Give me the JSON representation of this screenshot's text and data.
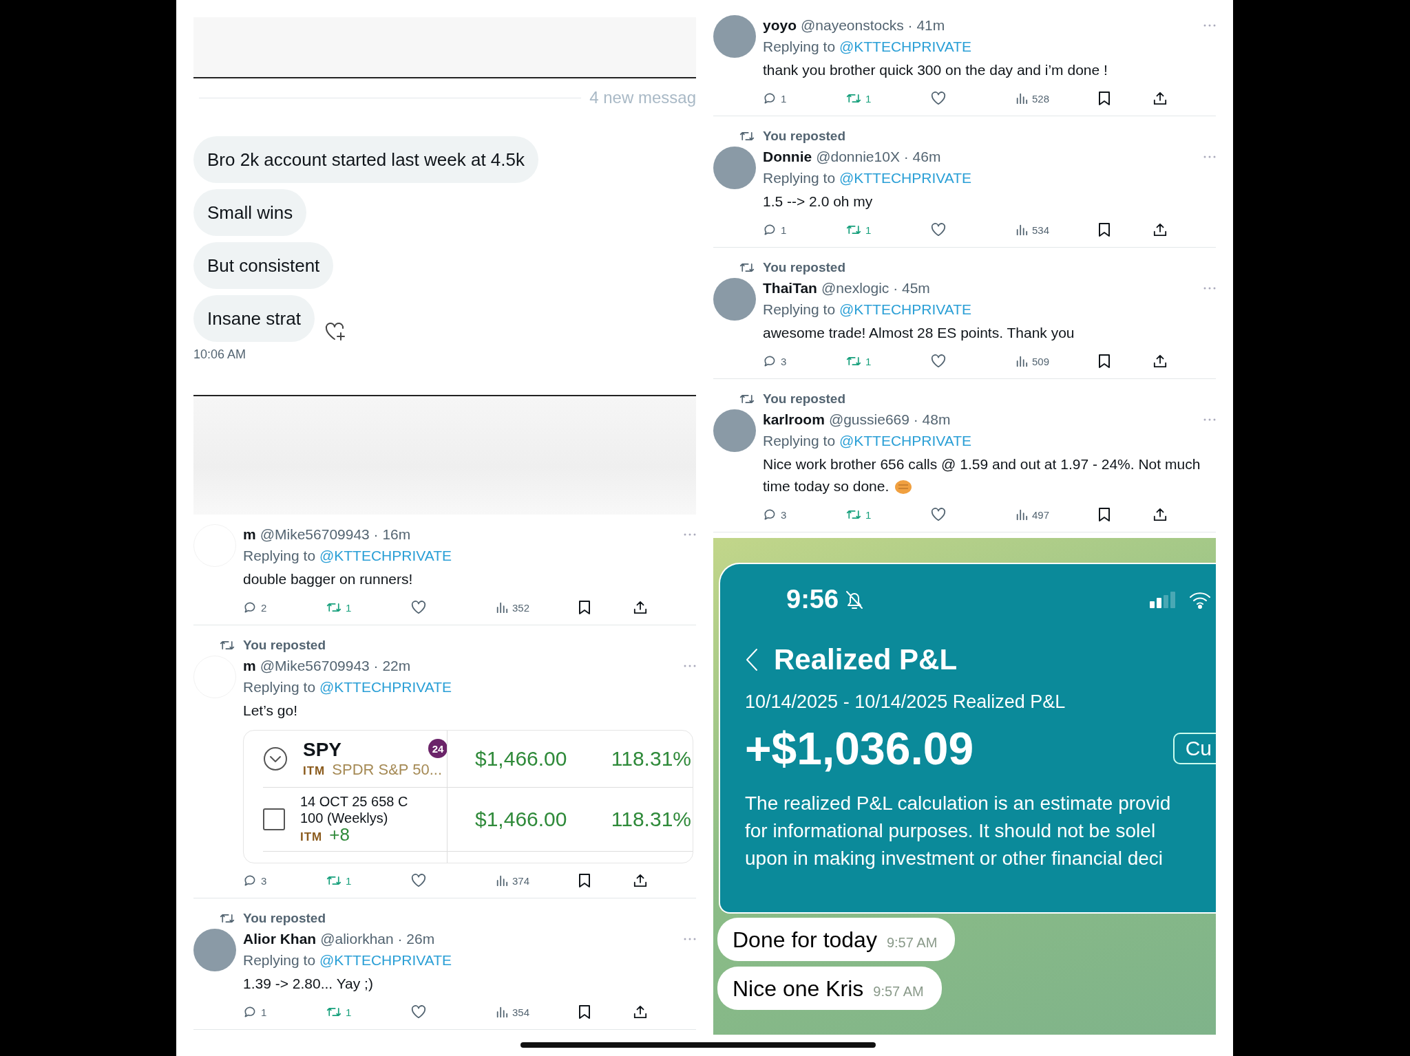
{
  "chat": {
    "new_messages": "4 new messag",
    "messages": [
      {
        "text": "Bro 2k account started last week at 4.5k"
      },
      {
        "text": "Small wins"
      },
      {
        "text": "But consistent"
      },
      {
        "text": "Insane strat"
      }
    ],
    "time": "10:06 AM"
  },
  "left_tweets": [
    {
      "avatar": {
        "kind": "blank"
      },
      "name": "m",
      "meta": "@Mike56709943 · 16m",
      "replying_prefix": "Replying to",
      "replying_to": "@KTTECHPRIVATE",
      "text": "double bagger on runners!",
      "replies": "2",
      "retweets": "1",
      "retweeted": true,
      "views": "352"
    },
    {
      "repost_label": "You reposted",
      "avatar": {
        "kind": "blank"
      },
      "name": "m",
      "meta": "@Mike56709943 · 22m",
      "replying_prefix": "Replying to",
      "replying_to": "@KTTECHPRIVATE",
      "text": "Let’s go!",
      "card": {
        "symbol": "SPY",
        "badge": "24",
        "tag": "ITM",
        "description": "SPDR S&P 50...",
        "value": "$1,466.00",
        "percent": "118.31%",
        "leg": {
          "checked": false,
          "line1": "14 OCT 25 658 C",
          "line2": "100 (Weeklys)",
          "tag": "ITM",
          "change": "+8",
          "value": "$1,466.00",
          "percent": "118.31%"
        }
      },
      "replies": "3",
      "retweets": "1",
      "retweeted": true,
      "views": "374"
    },
    {
      "repost_label": "You reposted",
      "avatar": {
        "kind": "photo"
      },
      "name": "Alior Khan",
      "meta": "@aliorkhan · 26m",
      "replying_prefix": "Replying to",
      "replying_to": "@KTTECHPRIVATE",
      "text": "1.39 -> 2.80... Yay ;)",
      "replies": "1",
      "retweets": "1",
      "retweeted": true,
      "views": "354"
    }
  ],
  "right_tweets": [
    {
      "avatar": {
        "kind": "photo"
      },
      "name": "yoyo",
      "meta": "@nayeonstocks · 41m",
      "replying_prefix": "Replying to",
      "replying_to": "@KTTECHPRIVATE",
      "text": "thank you brother quick 300 on the day and i’m done !",
      "replies": "1",
      "retweets": "1",
      "retweeted": true,
      "views": "528"
    },
    {
      "repost_label": "You reposted",
      "avatar": {
        "kind": "photo"
      },
      "name": "Donnie",
      "meta": "@donnie10X · 46m",
      "replying_prefix": "Replying to",
      "replying_to": "@KTTECHPRIVATE",
      "text": "1.5 --> 2.0 oh my",
      "replies": "1",
      "retweets": "1",
      "retweeted": true,
      "views": "534"
    },
    {
      "repost_label": "You reposted",
      "avatar": {
        "kind": "photo"
      },
      "name": "ThaiTan",
      "meta": "@nexlogic · 45m",
      "replying_prefix": "Replying to",
      "replying_to": "@KTTECHPRIVATE",
      "text": "awesome trade! Almost 28 ES points. Thank you",
      "replies": "3",
      "retweets": "1",
      "retweeted": true,
      "views": "509"
    },
    {
      "repost_label": "You reposted",
      "avatar": {
        "kind": "photo"
      },
      "name": "karlroom",
      "meta": "@gussie669 · 48m",
      "replying_prefix": "Replying to",
      "replying_to": "@KTTECHPRIVATE",
      "text": "Nice work brother  656 calls @ 1.59 and out at 1.97 - 24%. Not much time today so done.",
      "emoji": {
        "kind": "fist"
      },
      "replies": "3",
      "retweets": "1",
      "retweeted": true,
      "views": "497"
    }
  ],
  "pnl_chat": {
    "status_time": "9:56",
    "title": "Realized P&L",
    "date_range": "10/14/2025 - 10/14/2025 Realized P&L",
    "amount": "+$1,036.09",
    "button": "Cu",
    "disclaimer_lines": [
      "The realized P&L calculation is an estimate provid",
      "for informational purposes. It should not be solel",
      "upon in making investment or other financial deci"
    ],
    "messages": [
      {
        "text": "Done for today",
        "time": "9:57 AM"
      },
      {
        "text": "Nice one Kris",
        "time": "9:57 AM"
      }
    ]
  }
}
